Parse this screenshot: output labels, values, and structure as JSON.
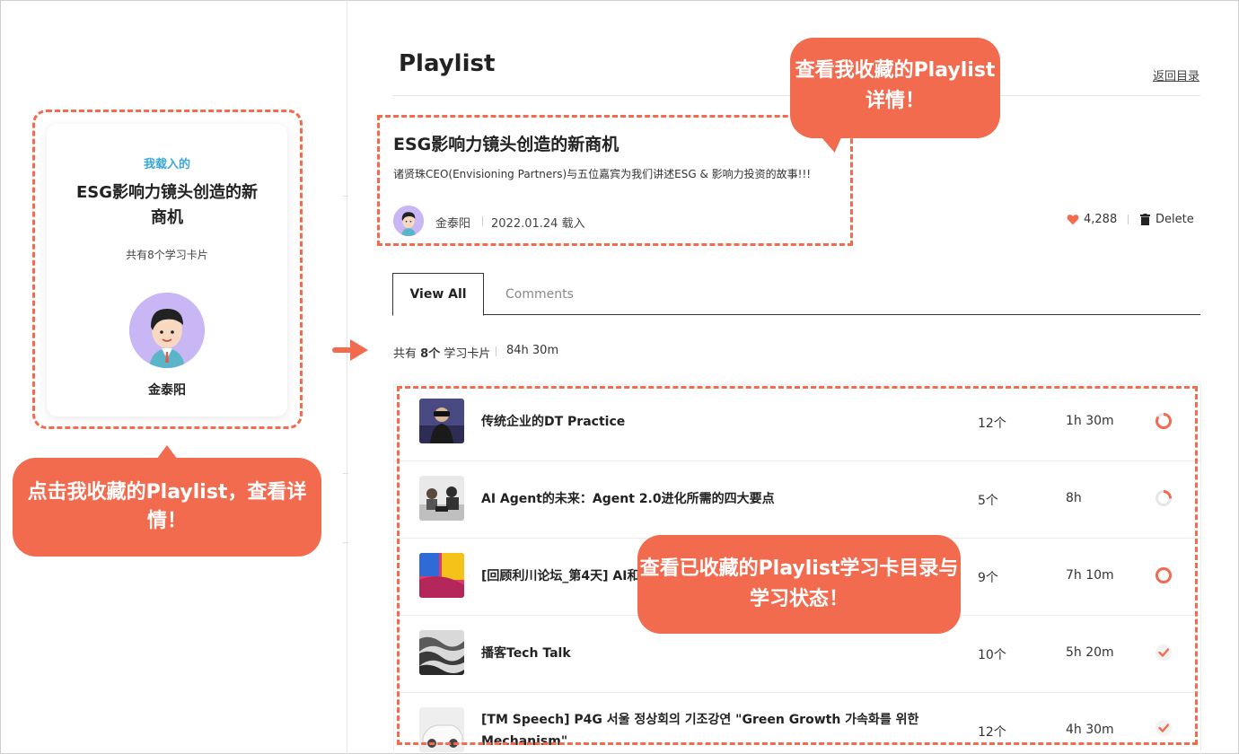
{
  "left_card": {
    "loaded_label": "我载入的",
    "title": "ESG影响力镜头创造的新商机",
    "count": "共有8个学习卡片",
    "author": "金泰阳"
  },
  "callouts": {
    "left": "点击我收藏的Playlist，查看详情！",
    "top": "查看我收藏的Playlist详情！",
    "mid": "查看已收藏的Playlist学习卡目录与学习状态！"
  },
  "header": {
    "title": "Playlist",
    "back_link": "返回目录"
  },
  "playlist": {
    "title": "ESG影响力镜头创造的新商机",
    "description": "诸贤珠CEO(Envisioning Partners)与五位嘉宾为我们讲述ESG & 影响力投资的故事!!!",
    "author": "金泰阳",
    "date": "2022.01.24 载入",
    "likes": "4,288",
    "delete_label": "Delete"
  },
  "tabs": [
    {
      "label": "View All",
      "active": true
    },
    {
      "label": "Comments",
      "active": false
    }
  ],
  "summary": {
    "prefix": "共有 ",
    "count": "8个",
    "suffix": " 学习卡片",
    "total_time": "84h 30m"
  },
  "cards": [
    {
      "title": "传统企业的DT Practice",
      "count": "12个",
      "time": "1h 30m",
      "status": "in-progress",
      "progress": 0.85
    },
    {
      "title": "AI Agent的未来：Agent 2.0进化所需的四大要点",
      "count": "5个",
      "time": "8h",
      "status": "in-progress",
      "progress": 0.6
    },
    {
      "title": "[回顾利川论坛_第4天] AI和…",
      "count": "9个",
      "time": "7h 10m",
      "status": "not-started",
      "progress": 0
    },
    {
      "title": "播客Tech Talk",
      "count": "10个",
      "time": "5h 20m",
      "status": "completed",
      "progress": 1
    },
    {
      "title": "[TM Speech] P4G 서울 정상회의 기조강연 \"Green Growth 가속화를 위한 Mechanism\"",
      "count": "12个",
      "time": "4h 30m",
      "status": "completed",
      "progress": 1
    }
  ],
  "colors": {
    "accent": "#f26b4f",
    "loaded_label": "#3aa7d9",
    "avatar_bg": "#c9b6f5"
  }
}
